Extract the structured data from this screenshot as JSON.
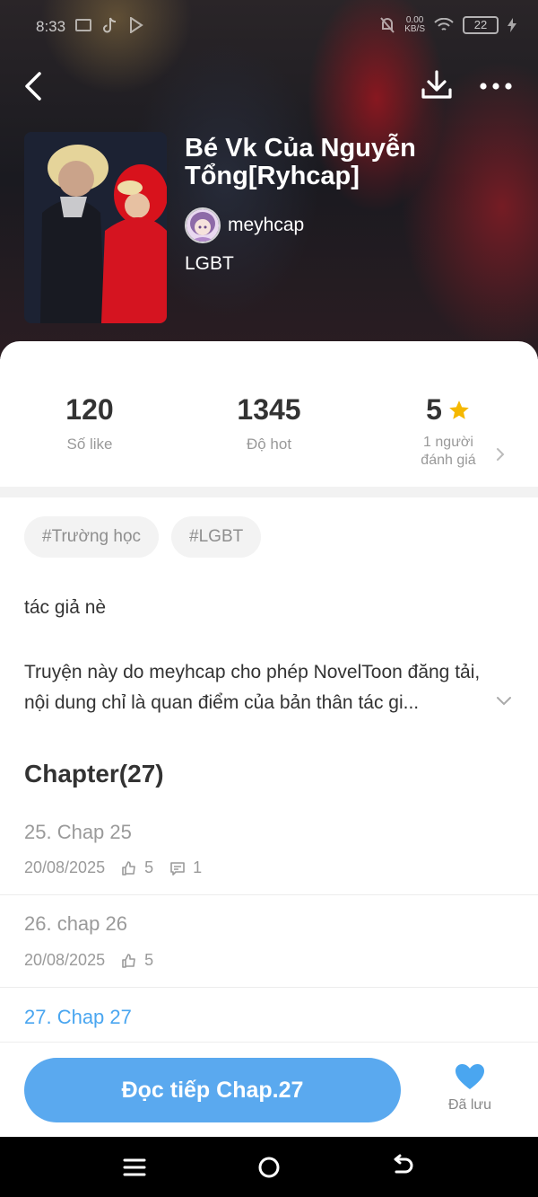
{
  "status_bar": {
    "time": "8:33",
    "net_speed_top": "0.00",
    "net_speed_bottom": "KB/S",
    "battery": "22"
  },
  "header": {
    "back_icon": "chevron-left-icon",
    "download_icon": "download-icon",
    "more_icon": "more-horizontal-icon"
  },
  "novel": {
    "title": "Bé Vk Của Nguyễn Tổng[Ryhcap]",
    "author": "meyhcap",
    "genre": "LGBT"
  },
  "stats": {
    "likes_value": "120",
    "likes_label": "Số like",
    "hot_value": "1345",
    "hot_label": "Độ hot",
    "rating_value": "5",
    "rating_label_line1": "1 người",
    "rating_label_line2": "đánh giá"
  },
  "tags": [
    "#Trường học",
    "#LGBT"
  ],
  "description": {
    "short": "tác giả nè",
    "long": "Truyện này do meyhcap cho phép NovelToon đăng tải, nội dung chỉ là quan điểm của bản thân tác gi..."
  },
  "chapters": {
    "heading": "Chapter(27)",
    "items": [
      {
        "title": "25. Chap 25",
        "date": "20/08/2025",
        "likes": "5",
        "comments": "1"
      },
      {
        "title": "26. chap 26",
        "date": "20/08/2025",
        "likes": "5"
      },
      {
        "title": "27. Chap 27"
      }
    ]
  },
  "bottom": {
    "read_button": "Đọc tiếp Chap.27",
    "save_label": "Đã lưu"
  },
  "colors": {
    "accent": "#5aa9ef",
    "active_chapter": "#4aa6f0",
    "star": "#f5b800",
    "muted": "#999999"
  }
}
